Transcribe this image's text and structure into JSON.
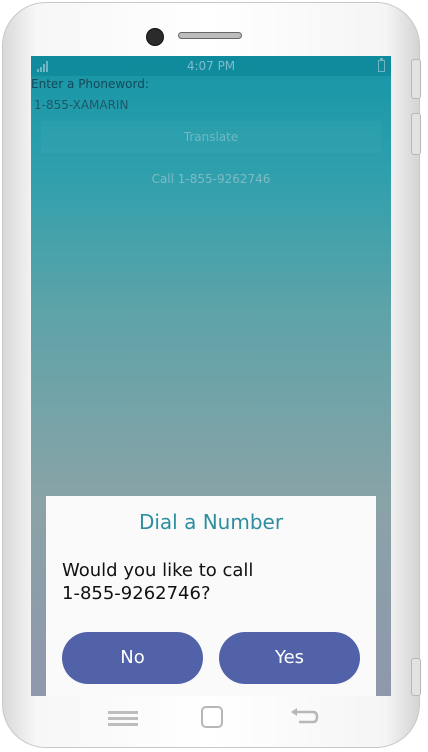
{
  "status_bar": {
    "time": "4:07 PM",
    "icons": [
      "signal-icon",
      "battery-icon"
    ]
  },
  "app": {
    "prompt_label": "Enter a Phoneword:",
    "phoneword_value": "1-855-XAMARIN",
    "translate_label": "Translate",
    "call_label": "Call 1-855-9262746"
  },
  "dialog": {
    "title": "Dial a Number",
    "message_line1": "Would you like to call",
    "message_line2": "1-855-9262746?",
    "no_label": "No",
    "yes_label": "Yes"
  },
  "nav_bar": {
    "icons": [
      "recent-apps-icon",
      "home-icon",
      "back-icon"
    ]
  },
  "colors": {
    "accent_teal": "#2e8ea0",
    "dialog_button": "#5262a9",
    "dialog_background": "#fafafa"
  }
}
